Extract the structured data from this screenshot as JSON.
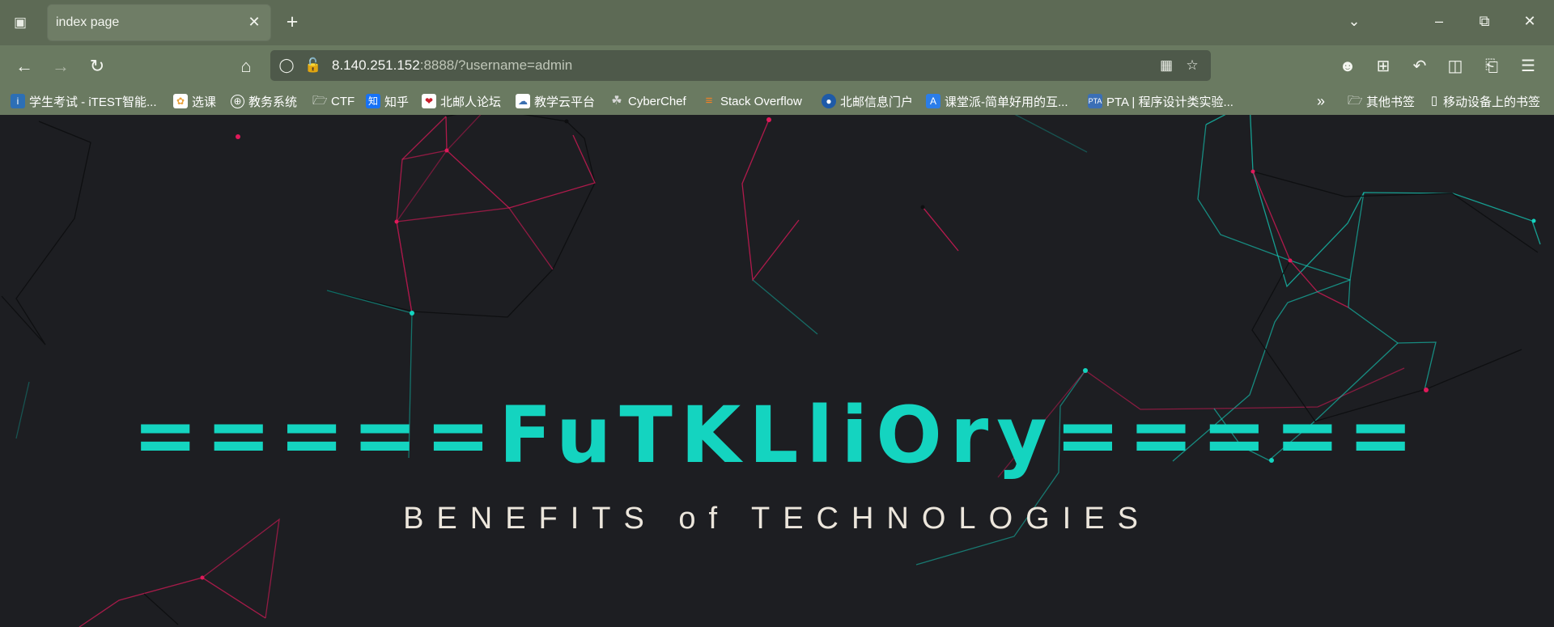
{
  "tab": {
    "title": "index page"
  },
  "address": {
    "host": "8.140.251.152",
    "rest": ":8888/?username=admin"
  },
  "bookmarks": [
    {
      "label": "学生考试 - iTEST智能...",
      "icon": "itest-icon",
      "color": "#2d6fb5"
    },
    {
      "label": "选课",
      "icon": "xuanke-icon",
      "color": "#e9a23b"
    },
    {
      "label": "教务系统",
      "icon": "globe-icon",
      "color": ""
    },
    {
      "label": "CTF",
      "icon": "folder-icon",
      "color": ""
    },
    {
      "label": "知乎",
      "icon": "zhihu-icon",
      "color": "#1772f6"
    },
    {
      "label": "北邮人论坛",
      "icon": "byr-icon",
      "color": "#c8202d"
    },
    {
      "label": "教学云平台",
      "icon": "cloud-icon",
      "color": "#3a6fb0"
    },
    {
      "label": "CyberChef",
      "icon": "chef-hat-icon",
      "color": "#d8d8d8"
    },
    {
      "label": "Stack Overflow",
      "icon": "stackoverflow-icon",
      "color": "#f48024"
    },
    {
      "label": "北邮信息门户",
      "icon": "bupt-icon",
      "color": "#1e5aa8"
    },
    {
      "label": "课堂派-简单好用的互...",
      "icon": "ketangpai-icon",
      "color": "#2b7de9"
    },
    {
      "label": "PTA | 程序设计类实验...",
      "icon": "pta-icon",
      "color": "#3b6fb6"
    }
  ],
  "bookmarks_right": {
    "other": "其他书签",
    "mobile": "移动设备上的书签"
  },
  "page": {
    "title": "=====FuTKLliOry=====",
    "subtitle": "BENEFITS of TECHNOLOGIES"
  },
  "colors": {
    "accent": "#14d4c0",
    "pink": "#e0195a",
    "background": "#1d1e22"
  }
}
